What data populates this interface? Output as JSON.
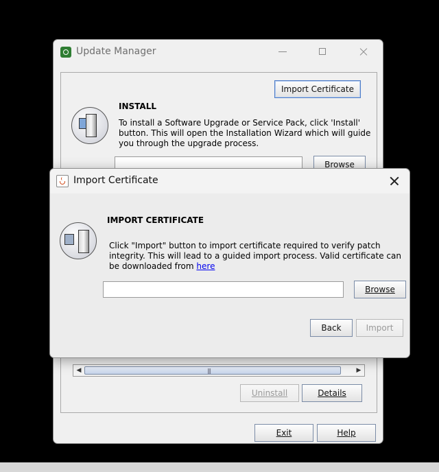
{
  "main_window": {
    "title": "Update Manager",
    "import_certificate_label": "Import Certificate",
    "install_heading": "INSTALL",
    "install_text": "To install a Software Upgrade or Service Pack, click 'Install' button. This will open the Installation Wizard which will guide you through the upgrade process.",
    "browse_label": "Browse",
    "uninstall_label": "Uninstall",
    "details_label": "Details",
    "exit_label": "Exit",
    "help_label": "Help"
  },
  "dialog": {
    "title": "Import Certificate",
    "heading": "IMPORT CERTIFICATE",
    "description": "Click \"Import\" button to import certificate required to verify patch integrity. This will lead to a guided import process. Valid certificate can be downloaded from ",
    "link_text": "here",
    "file_path_value": "",
    "browse_label": "Browse",
    "back_label": "Back",
    "import_label": "Import"
  },
  "icons": [
    "update-manager-app-icon",
    "minimize-icon",
    "maximize-icon",
    "close-icon",
    "computer-install-icon",
    "java-cup-icon",
    "computer-import-icon"
  ]
}
